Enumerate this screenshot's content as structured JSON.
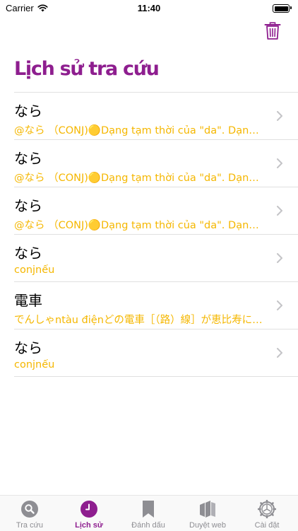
{
  "status_bar": {
    "carrier": "Carrier",
    "time": "11:40"
  },
  "page": {
    "title": "Lịch sử tra cứu"
  },
  "history": [
    {
      "word": "なら",
      "meaning": "@なら （CONJ)🟡Dạng tạm thời của \"da\". Dạng giả định"
    },
    {
      "word": "なら",
      "meaning": "@なら （CONJ)🟡Dạng tạm thời của \"da\". Dạng giả định"
    },
    {
      "word": "なら",
      "meaning": "@なら （CONJ)🟡Dạng tạm thời của \"da\". Dạng giả định"
    },
    {
      "word": "なら",
      "meaning": "conjnếu"
    },
    {
      "word": "電車",
      "meaning": "でんしゃntàu điệnどの電車［（路）線］が恵比寿に行きますか"
    },
    {
      "word": "なら",
      "meaning": "conjnếu"
    }
  ],
  "tabs": [
    {
      "label": "Tra cứu",
      "icon": "search-icon",
      "active": false
    },
    {
      "label": "Lịch sử",
      "icon": "clock-icon",
      "active": true
    },
    {
      "label": "Đánh dấu",
      "icon": "bookmark-icon",
      "active": false
    },
    {
      "label": "Duyệt web",
      "icon": "books-icon",
      "active": false
    },
    {
      "label": "Cài đặt",
      "icon": "gear-icon",
      "active": false
    }
  ],
  "colors": {
    "accent": "#8e1e8f",
    "meaning": "#f5b700",
    "inactive": "#8e8e93"
  }
}
